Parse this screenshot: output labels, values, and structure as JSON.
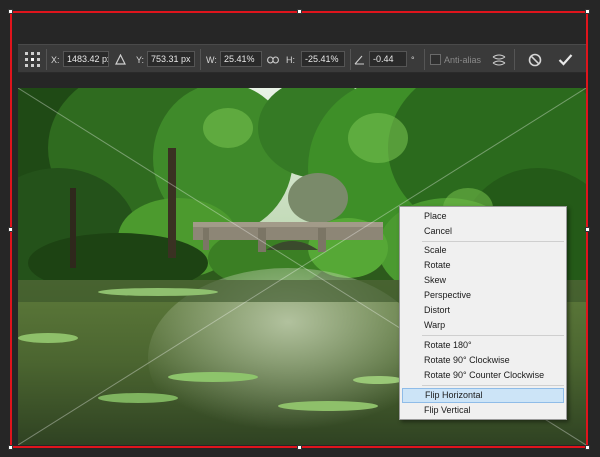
{
  "options_bar": {
    "x_label": "X:",
    "x_value": "1483.42 px",
    "y_label": "Y:",
    "y_value": "753.31 px",
    "w_label": "W:",
    "w_value": "25.41%",
    "h_label": "H:",
    "h_value": "-25.41%",
    "angle_value": "-0.44",
    "angle_unit": "°",
    "antialias_label": "Anti-alias"
  },
  "context_menu": {
    "items": [
      {
        "label": "Place"
      },
      {
        "label": "Cancel"
      },
      {
        "label": "Scale"
      },
      {
        "label": "Rotate"
      },
      {
        "label": "Skew"
      },
      {
        "label": "Perspective"
      },
      {
        "label": "Distort"
      },
      {
        "label": "Warp"
      },
      {
        "label": "Rotate 180°"
      },
      {
        "label": "Rotate 90° Clockwise"
      },
      {
        "label": "Rotate 90° Counter Clockwise"
      },
      {
        "label": "Flip Horizontal",
        "highlighted": true
      },
      {
        "label": "Flip Vertical"
      }
    ]
  },
  "colors": {
    "bounding_box": "#e0141c",
    "menu_highlight": "#cce4f7"
  }
}
